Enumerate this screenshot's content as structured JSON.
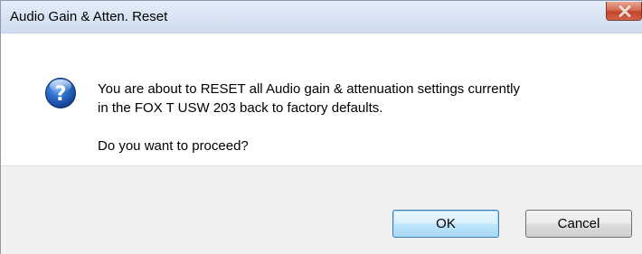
{
  "dialog": {
    "title": "Audio Gain & Atten. Reset",
    "close_label": "✕",
    "icon": "question-icon",
    "message_line1": "You are about to RESET all Audio gain & attenuation settings currently",
    "message_line2": "in the FOX T USW 203 back to factory defaults.",
    "question": "Do you want to proceed?",
    "buttons": {
      "ok_label": "OK",
      "cancel_label": "Cancel"
    }
  },
  "colors": {
    "titlebar": "#d9e5f3",
    "close_button": "#c7503a",
    "footer": "#f0f0f0",
    "icon_blue": "#1f5fb8"
  }
}
